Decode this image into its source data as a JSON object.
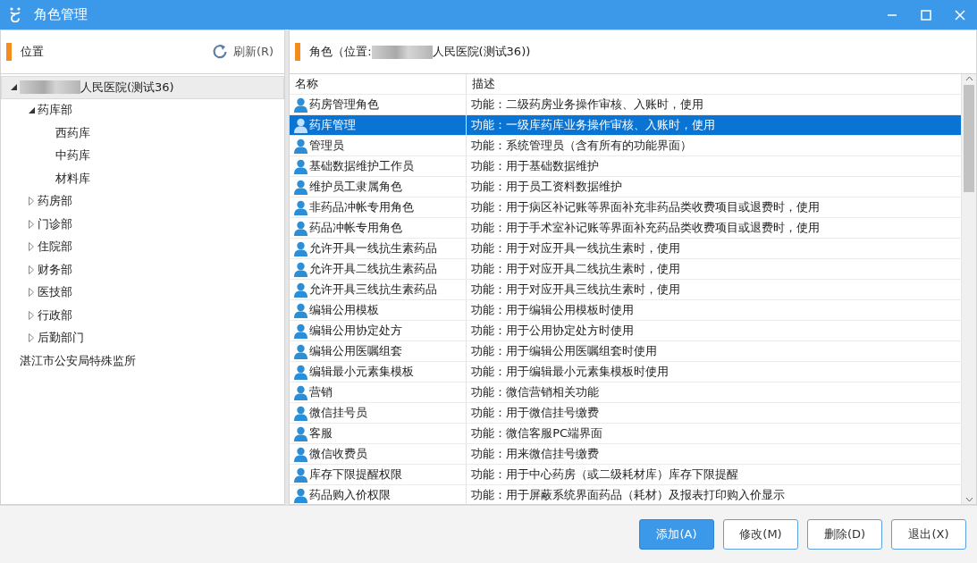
{
  "window": {
    "title": "角色管理"
  },
  "location_panel": {
    "title": "位置",
    "refresh_button": "刷新(R)",
    "tree": [
      {
        "label": "人民医院(测试36)",
        "redacted_prefix": true,
        "expanded": true,
        "selected": true,
        "children": [
          {
            "label": "药库部",
            "expanded": true,
            "selected": false,
            "children": [
              {
                "label": "西药库",
                "selected": false
              },
              {
                "label": "中药库",
                "selected": false
              },
              {
                "label": "材料库",
                "selected": false
              }
            ]
          },
          {
            "label": "药房部",
            "expanded": false,
            "selected": false
          },
          {
            "label": "门诊部",
            "expanded": false,
            "selected": false
          },
          {
            "label": "住院部",
            "expanded": false,
            "selected": false
          },
          {
            "label": "财务部",
            "expanded": false,
            "selected": false
          },
          {
            "label": "医技部",
            "expanded": false,
            "selected": false
          },
          {
            "label": "行政部",
            "expanded": false,
            "selected": false
          },
          {
            "label": "后勤部门",
            "expanded": false,
            "selected": false
          }
        ]
      },
      {
        "label": "湛江市公安局特殊监所",
        "selected": false
      }
    ]
  },
  "roles_panel": {
    "title_before": "角色（位置:",
    "title_after": "人民医院(测试36))",
    "columns": [
      "名称",
      "描述"
    ],
    "rows": [
      {
        "name": "药房管理角色",
        "description": "功能：二级药房业务操作审核、入账时，使用",
        "selected": false
      },
      {
        "name": "药库管理",
        "description": "功能：一级库药库业务操作审核、入账时，使用",
        "selected": true
      },
      {
        "name": "管理员",
        "description": "功能：系统管理员（含有所有的功能界面）",
        "selected": false
      },
      {
        "name": "基础数据维护工作员",
        "description": "功能：用于基础数据维护",
        "selected": false
      },
      {
        "name": "维护员工隶属角色",
        "description": "功能：用于员工资料数据维护",
        "selected": false
      },
      {
        "name": "非药品冲帐专用角色",
        "description": "功能：用于病区补记账等界面补充非药品类收费项目或退费时，使用",
        "selected": false
      },
      {
        "name": "药品冲帐专用角色",
        "description": "功能：用于手术室补记账等界面补充药品类收费项目或退费时，使用",
        "selected": false
      },
      {
        "name": "允许开具一线抗生素药品",
        "description": "功能：用于对应开具一线抗生素时，使用",
        "selected": false
      },
      {
        "name": "允许开具二线抗生素药品",
        "description": "功能：用于对应开具二线抗生素时，使用",
        "selected": false
      },
      {
        "name": "允许开具三线抗生素药品",
        "description": "功能：用于对应开具三线抗生素时，使用",
        "selected": false
      },
      {
        "name": "编辑公用模板",
        "description": "功能：用于编辑公用模板时使用",
        "selected": false
      },
      {
        "name": "编辑公用协定处方",
        "description": "功能：用于公用协定处方时使用",
        "selected": false
      },
      {
        "name": "编辑公用医嘱组套",
        "description": "功能：用于编辑公用医嘱组套时使用",
        "selected": false
      },
      {
        "name": "编辑最小元素集模板",
        "description": "功能：用于编辑最小元素集模板时使用",
        "selected": false
      },
      {
        "name": "营销",
        "description": "功能：微信营销相关功能",
        "selected": false
      },
      {
        "name": "微信挂号员",
        "description": "功能：用于微信挂号缴费",
        "selected": false
      },
      {
        "name": "客服",
        "description": "功能：微信客服PC端界面",
        "selected": false
      },
      {
        "name": "微信收费员",
        "description": "功能：用来微信挂号缴费",
        "selected": false
      },
      {
        "name": "库存下限提醒权限",
        "description": "功能：用于中心药房（或二级耗材库）库存下限提醒",
        "selected": false
      },
      {
        "name": "药品购入价权限",
        "description": "功能：用于屏蔽系统界面药品（耗材）及报表打印购入价显示",
        "selected": false
      }
    ]
  },
  "buttons": [
    {
      "label": "添加(A)",
      "primary": true
    },
    {
      "label": "修改(M)",
      "primary": false
    },
    {
      "label": "删除(D)",
      "primary": false
    },
    {
      "label": "退出(X)",
      "primary": false
    }
  ]
}
